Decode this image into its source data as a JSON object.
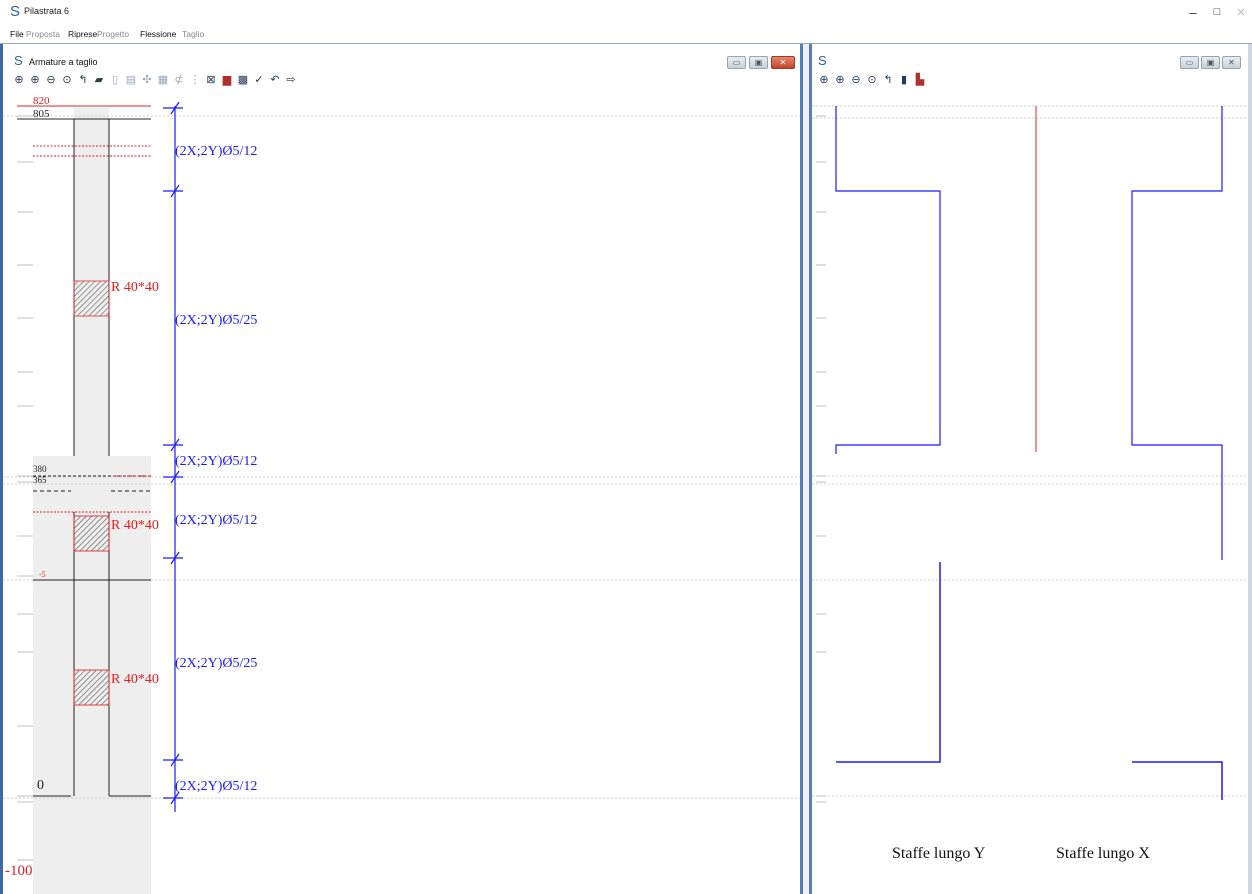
{
  "app": {
    "logo": "S",
    "title": "Pilastrata 6",
    "window_controls": [
      "–",
      "□",
      "✕"
    ]
  },
  "menu": [
    {
      "label": "File",
      "enabled": true
    },
    {
      "label": "Proposta",
      "enabled": false
    },
    {
      "label": "Riprese",
      "enabled": true
    },
    {
      "label": "Progetto",
      "enabled": false
    },
    {
      "label": "Flessione",
      "enabled": true
    },
    {
      "label": "Taglio",
      "enabled": false
    }
  ],
  "left_window": {
    "logo": "S",
    "title": "Armature a taglio",
    "controls": [
      "▭",
      "▣",
      "✕"
    ],
    "toolbar_icons": [
      "zoom-extents-icon",
      "zoom-in-icon",
      "zoom-out-icon",
      "zoom-window-icon",
      "pan-icon",
      "open-icon",
      "page-icon",
      "grid-icon",
      "move-icon",
      "table-icon",
      "stirrup-icon",
      "rebar-icon",
      "section-icon",
      "column-icon",
      "layers-icon",
      "check-icon",
      "undo-icon",
      "export-icon"
    ]
  },
  "right_window": {
    "logo": "S",
    "controls": [
      "▭",
      "▣",
      "✕"
    ],
    "toolbar_icons": [
      "zoom-extents-icon",
      "zoom-in-icon",
      "zoom-out-icon",
      "zoom-window-icon",
      "pan-icon",
      "copy-icon",
      "print-icon"
    ]
  },
  "drawing": {
    "level_labels": {
      "top_red": "820",
      "top_black": "805",
      "mid_a": "380",
      "mid_b": "365",
      "low": "-5",
      "zero": "0",
      "bottom": "-100"
    },
    "section_labels": [
      "R 40*40",
      "R 40*40",
      "R 40*40"
    ],
    "stirrup_labels": [
      "(2X;2Y)Ø5/12",
      "(2X;2Y)Ø5/25",
      "(2X;2Y)Ø5/12",
      "(2X;2Y)Ø5/12",
      "(2X;2Y)Ø5/25",
      "(2X;2Y)Ø5/12"
    ],
    "captions": {
      "y": "Staffe lungo Y",
      "x": "Staffe lungo X"
    }
  },
  "colors": {
    "line_blue": "#1a1aff",
    "line_red": "#e02020",
    "frame_blue": "#3f6aa8",
    "column_fill": "#eeeeee"
  }
}
